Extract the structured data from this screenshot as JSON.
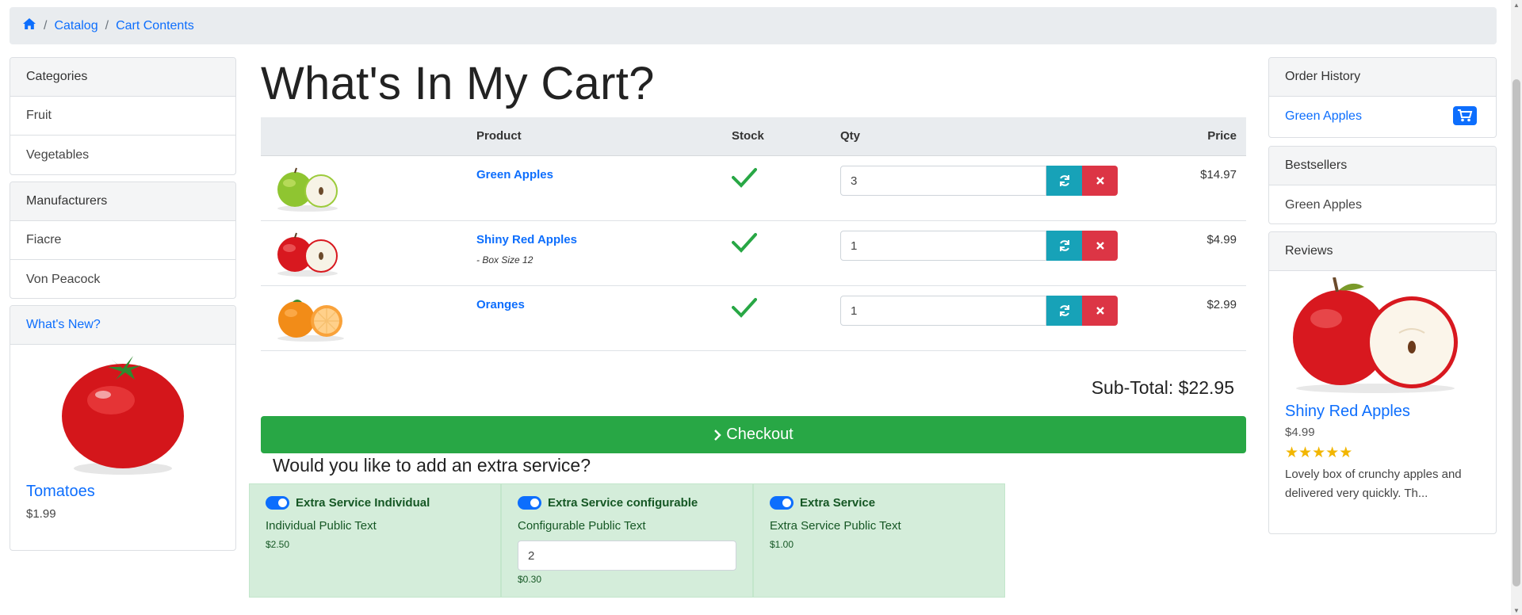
{
  "breadcrumb": {
    "home_icon": "home-icon",
    "items": [
      "Catalog",
      "Cart Contents"
    ],
    "separator": "/"
  },
  "sidebar_left": {
    "categories": {
      "title": "Categories",
      "items": [
        "Fruit",
        "Vegetables"
      ]
    },
    "manufacturers": {
      "title": "Manufacturers",
      "items": [
        "Fiacre",
        "Von Peacock"
      ]
    },
    "whats_new": {
      "title": "What's New?",
      "product_name": "Tomatoes",
      "price": "$1.99"
    }
  },
  "main": {
    "title": "What's In My Cart?",
    "table": {
      "headers": {
        "product": "Product",
        "stock": "Stock",
        "qty": "Qty",
        "price": "Price"
      },
      "rows": [
        {
          "name": "Green Apples",
          "attribute": "",
          "qty": "3",
          "price": "$14.97"
        },
        {
          "name": "Shiny Red Apples",
          "attribute": "- Box Size 12",
          "qty": "1",
          "price": "$4.99"
        },
        {
          "name": "Oranges",
          "attribute": "",
          "qty": "1",
          "price": "$2.99"
        }
      ]
    },
    "subtotal": "Sub-Total: $22.95",
    "checkout_label": "Checkout",
    "extra_title": "Would you like to add an extra service?",
    "extras": [
      {
        "name": "Extra Service Individual",
        "text": "Individual Public Text",
        "price": "$2.50",
        "input": ""
      },
      {
        "name": "Extra Service configurable",
        "text": "Configurable Public Text",
        "price": "$0.30",
        "input": "2"
      },
      {
        "name": "Extra Service",
        "text": "Extra Service Public Text",
        "price": "$1.00",
        "input": ""
      }
    ]
  },
  "sidebar_right": {
    "order_history": {
      "title": "Order History",
      "item": "Green Apples"
    },
    "bestsellers": {
      "title": "Bestsellers",
      "item": "Green Apples"
    },
    "reviews": {
      "title": "Reviews",
      "product_name": "Shiny Red Apples",
      "price": "$4.99",
      "rating": 5,
      "text_line1": "Lovely box of crunchy apples and",
      "text_line2": "delivered very quickly. Th..."
    }
  },
  "colors": {
    "primary": "#0d6efd",
    "success": "#28a745",
    "info": "#17a2b8",
    "danger": "#dc3545",
    "extra_bg": "#d4edda"
  }
}
